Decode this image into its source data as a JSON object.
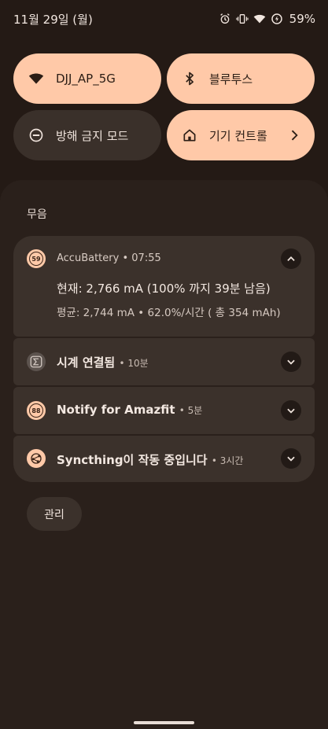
{
  "status_bar": {
    "datetime": "11월 29일 (월)",
    "battery": "59%",
    "icons": [
      "alarm-icon",
      "vibrate-icon",
      "wifi-icon",
      "battery-saver-icon"
    ]
  },
  "quick_tiles": [
    {
      "label": "DJJ_AP_5G",
      "icon": "wifi-icon",
      "state": "on"
    },
    {
      "label": "블루투스",
      "icon": "bluetooth-icon",
      "state": "on"
    },
    {
      "label": "방해 금지 모드",
      "icon": "do-not-disturb-icon",
      "state": "off"
    },
    {
      "label": "기기 컨트롤",
      "icon": "home-icon",
      "state": "on"
    }
  ],
  "section_label": "무음",
  "notifications": [
    {
      "app": "AccuBattery",
      "time": "07:55",
      "badge": "59",
      "main": "현재: 2,766 mA (100% 까지 39분 남음)",
      "sub": "평균: 2,744 mA • 62.0%/시간 ( 총 354 mAh)",
      "expanded": true
    },
    {
      "title": "시계 연결됨",
      "time": "10분",
      "icon": "sigma-icon"
    },
    {
      "title": "Notify for Amazfit",
      "time": "5분",
      "badge": "88"
    },
    {
      "title": "Syncthing이 작동 중입니다",
      "time": "3시간",
      "icon": "sync-icon"
    }
  ],
  "manage_label": "관리",
  "colors": {
    "accent": "#ffc9a8",
    "background": "#241a15",
    "card": "#3b312b"
  }
}
